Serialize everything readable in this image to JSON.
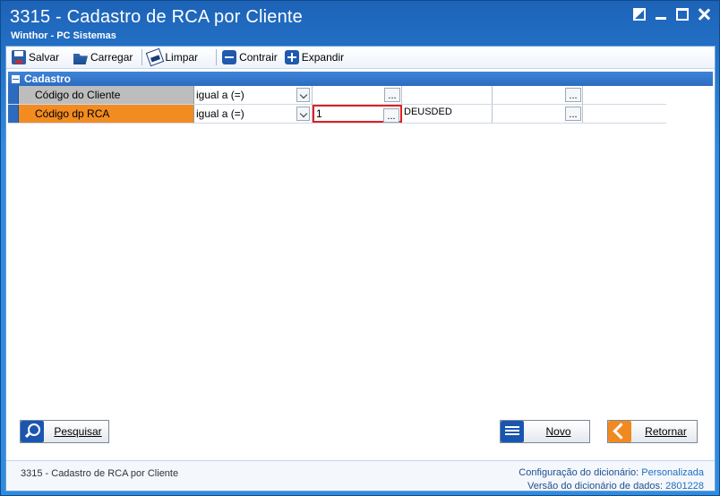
{
  "window": {
    "title": "3315 - Cadastro de RCA por Cliente",
    "subtitle": "Winthor - PC Sistemas"
  },
  "toolbar": {
    "save_label": "Salvar",
    "load_label": "Carregar",
    "clear_label": "Limpar",
    "collapse_label": "Contrair",
    "expand_label": "Expandir"
  },
  "group": {
    "title": "Cadastro"
  },
  "rows": [
    {
      "label": "Código do Cliente",
      "operator": "igual a (=)",
      "value": "",
      "description": "",
      "value2": ""
    },
    {
      "label": "Código dp RCA",
      "operator": "igual a (=)",
      "value": "1",
      "description": "DEUSDED",
      "value2": ""
    }
  ],
  "ellipsis": "...",
  "buttons": {
    "search": "Pesquisar",
    "new": "Novo",
    "back": "Retornar"
  },
  "status": {
    "form_name": "3315 - Cadastro de RCA por Cliente",
    "dict_config_label": "Configuração do dicionário:",
    "dict_config_value": "Personalizada",
    "dict_version_label": "Versão do dicionário de dados:",
    "dict_version_value": "2801228"
  },
  "colors": {
    "title_bar": "#2f8be0",
    "row1_label": "#bdbdbd",
    "row2_label": "#f28b20",
    "active_cell_border": "#e02020"
  }
}
